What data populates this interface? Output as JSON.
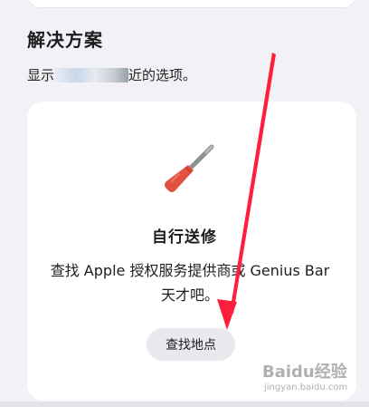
{
  "section": {
    "title": "解决方案",
    "subtitle_prefix": "显示",
    "subtitle_suffix": "近的选项。"
  },
  "card": {
    "icon": "screwdriver-icon",
    "title": "自行送修",
    "description": "查找 Apple 授权服务提供商或 Genius Bar 天才吧。",
    "button_label": "查找地点"
  },
  "watermark": {
    "brand": "Baidu经验",
    "url": "jingyan.baidu.com"
  },
  "colors": {
    "background": "#f2f2f6",
    "card": "#ffffff",
    "button": "#e8e8ed",
    "tool_handle": "#e0523f",
    "tool_shaft": "#8d9196",
    "annotation_arrow": "#ff1f3d"
  }
}
